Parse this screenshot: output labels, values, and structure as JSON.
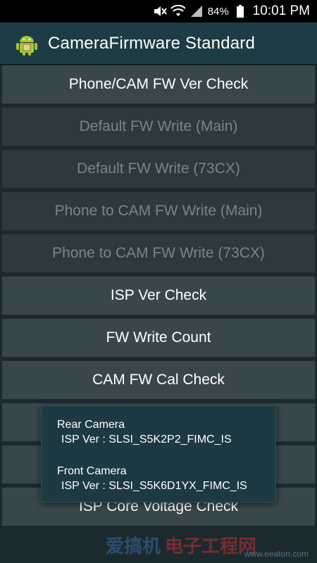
{
  "status_bar": {
    "icons": [
      "mute-icon",
      "wifi-icon",
      "signal-icon",
      "battery-icon"
    ],
    "battery": "84%",
    "time": "10:01 PM"
  },
  "app_bar": {
    "icon": "android-icon",
    "title": "CameraFirmware Standard"
  },
  "buttons": [
    {
      "label": "Phone/CAM FW Ver Check",
      "enabled": true
    },
    {
      "label": "Default FW Write (Main)",
      "enabled": false
    },
    {
      "label": "Default FW Write (73CX)",
      "enabled": false
    },
    {
      "label": "Phone to CAM FW Write (Main)",
      "enabled": false
    },
    {
      "label": "Phone to CAM FW Write (73CX)",
      "enabled": false
    },
    {
      "label": "ISP Ver Check",
      "enabled": true
    },
    {
      "label": "FW Write Count",
      "enabled": true
    },
    {
      "label": "CAM FW Cal Check",
      "enabled": true
    },
    {
      "label": "",
      "enabled": true
    },
    {
      "label": "",
      "enabled": true
    },
    {
      "label": "ISP Core Voltage Check",
      "enabled": true
    }
  ],
  "popup": {
    "rear_title": "Rear Camera",
    "rear_ver": "ISP Ver : SLSI_S5K2P2_FIMC_IS",
    "front_title": "Front Camera",
    "front_ver": "ISP Ver : SLSI_S5K6D1YX_FIMC_IS"
  },
  "watermark": {
    "text1": "爱搞机",
    "text2": "电子工程网",
    "text3": "www.eeaton.com"
  },
  "colors": {
    "status_bar": "#000000",
    "app_bar": "#1e3c44",
    "background": "#1c2a2e",
    "button": "#39474b",
    "button_disabled_text": "#77858a",
    "popup": "#1d3a42"
  }
}
